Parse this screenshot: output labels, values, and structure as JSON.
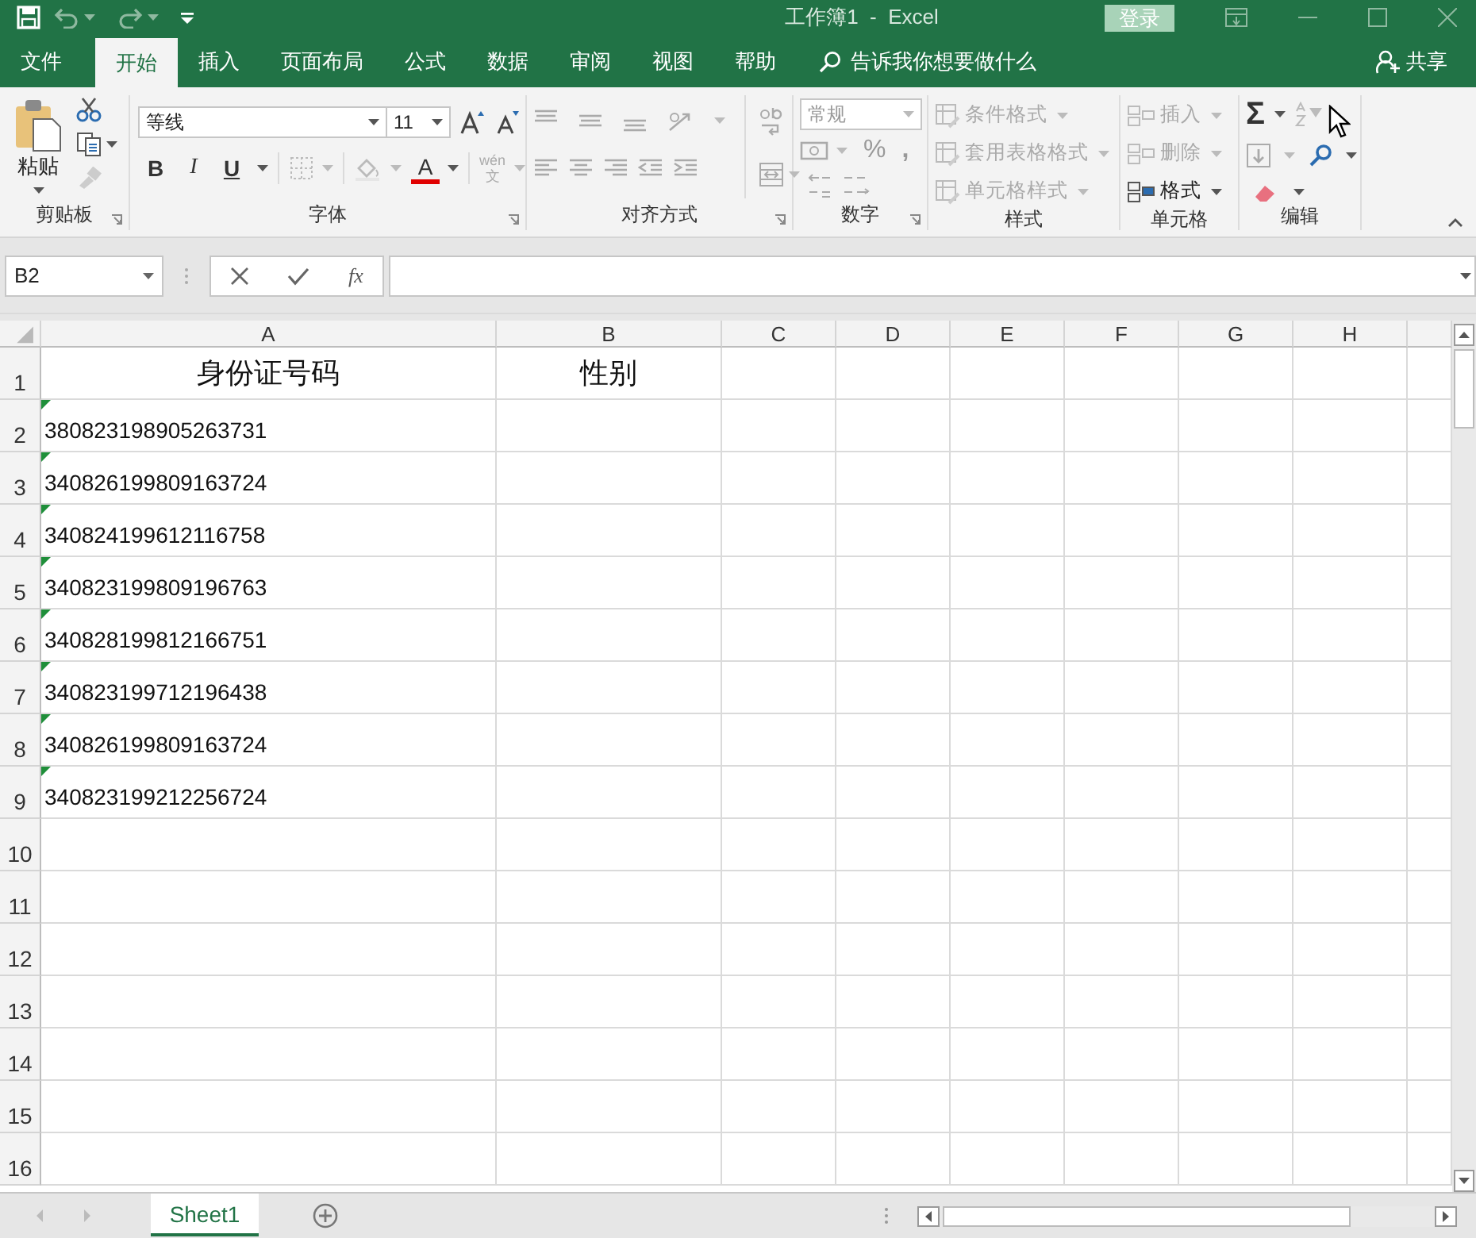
{
  "title_bar": {
    "title": "工作簿1  -  Excel",
    "login_button": "登录"
  },
  "menu_tabs": [
    {
      "label": "文件",
      "selected": false
    },
    {
      "label": "开始",
      "selected": true
    },
    {
      "label": "插入",
      "selected": false
    },
    {
      "label": "页面布局",
      "selected": false
    },
    {
      "label": "公式",
      "selected": false
    },
    {
      "label": "数据",
      "selected": false
    },
    {
      "label": "审阅",
      "selected": false
    },
    {
      "label": "视图",
      "selected": false
    },
    {
      "label": "帮助",
      "selected": false
    }
  ],
  "tell_me": "告诉我你想要做什么",
  "share_button": "共享",
  "ribbon": {
    "clipboard": {
      "paste": "粘贴",
      "label": "剪贴板"
    },
    "font": {
      "font_name": "等线",
      "font_size": "11",
      "bold": "B",
      "italic": "I",
      "underline": "U",
      "font_color": "A",
      "phonetic": "wén",
      "phonetic_char": "文",
      "label": "字体"
    },
    "alignment": {
      "label": "对齐方式"
    },
    "number": {
      "format": "常规",
      "percent": "%",
      "comma": ",",
      "label": "数字"
    },
    "styles": {
      "items": [
        {
          "label": "条件格式",
          "disabled": true
        },
        {
          "label": "套用表格格式",
          "disabled": true
        },
        {
          "label": "单元格样式",
          "disabled": true
        }
      ],
      "label": "样式"
    },
    "cells": {
      "items": [
        {
          "label": "插入",
          "disabled": true
        },
        {
          "label": "删除",
          "disabled": true
        },
        {
          "label": "格式",
          "disabled": false
        }
      ],
      "label": "单元格"
    },
    "editing": {
      "sum": "Σ",
      "label": "编辑"
    }
  },
  "formula_bar": {
    "name_box": "B2",
    "function_label": "fx"
  },
  "columns": [
    "A",
    "B",
    "C",
    "D",
    "E",
    "F",
    "G",
    "H"
  ],
  "rows": [
    {
      "header": "1",
      "kind": "title",
      "cells": [
        "身份证号码",
        "性别"
      ],
      "error_mark": false
    },
    {
      "header": "2",
      "kind": "data",
      "cells": [
        "380823198905263731"
      ],
      "error_mark": true
    },
    {
      "header": "3",
      "kind": "data",
      "cells": [
        "340826199809163724"
      ],
      "error_mark": true
    },
    {
      "header": "4",
      "kind": "data",
      "cells": [
        "340824199612116758"
      ],
      "error_mark": true
    },
    {
      "header": "5",
      "kind": "data",
      "cells": [
        "340823199809196763"
      ],
      "error_mark": true
    },
    {
      "header": "6",
      "kind": "data",
      "cells": [
        "340828199812166751"
      ],
      "error_mark": true
    },
    {
      "header": "7",
      "kind": "data",
      "cells": [
        "340823199712196438"
      ],
      "error_mark": true
    },
    {
      "header": "8",
      "kind": "data",
      "cells": [
        "340826199809163724"
      ],
      "error_mark": true
    },
    {
      "header": "9",
      "kind": "data",
      "cells": [
        "340823199212256724"
      ],
      "error_mark": true
    },
    {
      "header": "10",
      "kind": "data",
      "cells": [],
      "error_mark": false
    },
    {
      "header": "11",
      "kind": "data",
      "cells": [],
      "error_mark": false
    },
    {
      "header": "12",
      "kind": "data",
      "cells": [],
      "error_mark": false
    },
    {
      "header": "13",
      "kind": "data",
      "cells": [],
      "error_mark": false
    },
    {
      "header": "14",
      "kind": "data",
      "cells": [],
      "error_mark": false
    },
    {
      "header": "15",
      "kind": "data",
      "cells": [],
      "error_mark": false
    },
    {
      "header": "16",
      "kind": "data",
      "cells": [],
      "error_mark": false
    }
  ],
  "sheet_tabs": [
    {
      "label": "Sheet1",
      "selected": true
    }
  ]
}
